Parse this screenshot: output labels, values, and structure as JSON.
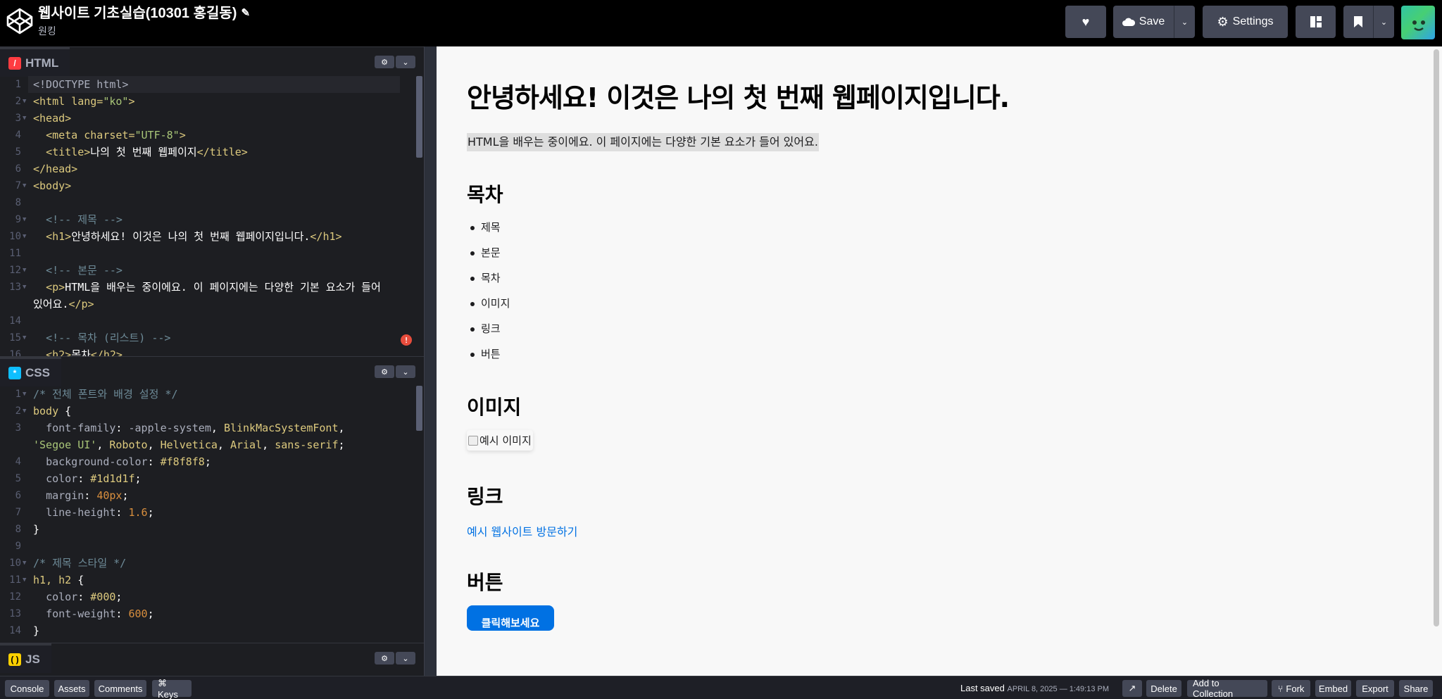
{
  "header": {
    "title": "웹사이트 기초실습(10301 홍길동)",
    "author": "원킹",
    "save_label": "Save",
    "settings_label": "Settings"
  },
  "editors": {
    "html": {
      "label": "HTML",
      "lines": [
        {
          "n": "1",
          "fold": false,
          "parts": [
            {
              "c": "c-prop",
              "t": "<!DOCTYPE html>"
            }
          ]
        },
        {
          "n": "2",
          "fold": true,
          "parts": [
            {
              "c": "c-tag",
              "t": "<html "
            },
            {
              "c": "c-attr",
              "t": "lang="
            },
            {
              "c": "c-str",
              "t": "\"ko\""
            },
            {
              "c": "c-tag",
              "t": ">"
            }
          ]
        },
        {
          "n": "3",
          "fold": true,
          "parts": [
            {
              "c": "c-tag",
              "t": "<head>"
            }
          ]
        },
        {
          "n": "4",
          "fold": false,
          "parts": [
            {
              "c": "",
              "t": "  "
            },
            {
              "c": "c-tag",
              "t": "<meta "
            },
            {
              "c": "c-attr",
              "t": "charset="
            },
            {
              "c": "c-str",
              "t": "\"UTF-8\""
            },
            {
              "c": "c-tag",
              "t": ">"
            }
          ]
        },
        {
          "n": "5",
          "fold": false,
          "parts": [
            {
              "c": "",
              "t": "  "
            },
            {
              "c": "c-tag",
              "t": "<title>"
            },
            {
              "c": "",
              "t": "나의 첫 번째 웹페이지"
            },
            {
              "c": "c-tag",
              "t": "</title>"
            }
          ]
        },
        {
          "n": "6",
          "fold": false,
          "parts": [
            {
              "c": "c-tag",
              "t": "</head>"
            }
          ]
        },
        {
          "n": "7",
          "fold": true,
          "parts": [
            {
              "c": "c-tag",
              "t": "<body>"
            }
          ]
        },
        {
          "n": "8",
          "fold": false,
          "parts": [
            {
              "c": "",
              "t": ""
            }
          ]
        },
        {
          "n": "9",
          "fold": true,
          "parts": [
            {
              "c": "",
              "t": "  "
            },
            {
              "c": "c-cmt",
              "t": "<!-- 제목 -->"
            }
          ]
        },
        {
          "n": "10",
          "fold": true,
          "parts": [
            {
              "c": "",
              "t": "  "
            },
            {
              "c": "c-tag",
              "t": "<h1>"
            },
            {
              "c": "",
              "t": "안녕하세요! 이것은 나의 첫 번째 웹페이지입니다."
            },
            {
              "c": "c-tag",
              "t": "</h1>"
            }
          ]
        },
        {
          "n": "11",
          "fold": false,
          "parts": [
            {
              "c": "",
              "t": ""
            }
          ]
        },
        {
          "n": "12",
          "fold": true,
          "parts": [
            {
              "c": "",
              "t": "  "
            },
            {
              "c": "c-cmt",
              "t": "<!-- 본문 -->"
            }
          ]
        },
        {
          "n": "13",
          "fold": true,
          "parts": [
            {
              "c": "",
              "t": "  "
            },
            {
              "c": "c-tag",
              "t": "<p>"
            },
            {
              "c": "",
              "t": "HTML을 배우는 중이에요. 이 페이지에는 다양한 기본 요소가 들어"
            }
          ]
        },
        {
          "n": "",
          "fold": false,
          "parts": [
            {
              "c": "",
              "t": "있어요."
            },
            {
              "c": "c-tag",
              "t": "</p>"
            }
          ]
        },
        {
          "n": "14",
          "fold": false,
          "parts": [
            {
              "c": "",
              "t": ""
            }
          ]
        },
        {
          "n": "15",
          "fold": true,
          "parts": [
            {
              "c": "",
              "t": "  "
            },
            {
              "c": "c-cmt",
              "t": "<!-- 목차 (리스트) -->"
            }
          ]
        },
        {
          "n": "16",
          "fold": false,
          "parts": [
            {
              "c": "",
              "t": "  "
            },
            {
              "c": "c-tag",
              "t": "<h2>"
            },
            {
              "c": "",
              "t": "목차"
            },
            {
              "c": "c-tag",
              "t": "</h2>"
            }
          ]
        }
      ]
    },
    "css": {
      "label": "CSS",
      "lines": [
        {
          "n": "1",
          "fold": true,
          "parts": [
            {
              "c": "c-cmt",
              "t": "/* 전체 폰트와 배경 설정 */"
            }
          ]
        },
        {
          "n": "2",
          "fold": true,
          "parts": [
            {
              "c": "c-sel",
              "t": "body"
            },
            {
              "c": "",
              "t": " {"
            }
          ]
        },
        {
          "n": "3",
          "fold": false,
          "parts": [
            {
              "c": "",
              "t": "  "
            },
            {
              "c": "c-prop",
              "t": "font-family"
            },
            {
              "c": "",
              "t": ": "
            },
            {
              "c": "c-prop",
              "t": "-apple-system"
            },
            {
              "c": "",
              "t": ", "
            },
            {
              "c": "c-sel",
              "t": "BlinkMacSystemFont"
            },
            {
              "c": "",
              "t": ","
            }
          ]
        },
        {
          "n": "",
          "fold": false,
          "parts": [
            {
              "c": "c-str",
              "t": "'Segoe UI'"
            },
            {
              "c": "",
              "t": ", "
            },
            {
              "c": "c-sel",
              "t": "Roboto"
            },
            {
              "c": "",
              "t": ", "
            },
            {
              "c": "c-sel",
              "t": "Helvetica"
            },
            {
              "c": "",
              "t": ", "
            },
            {
              "c": "c-sel",
              "t": "Arial"
            },
            {
              "c": "",
              "t": ", "
            },
            {
              "c": "c-sel",
              "t": "sans-serif"
            },
            {
              "c": "",
              "t": ";"
            }
          ]
        },
        {
          "n": "4",
          "fold": false,
          "parts": [
            {
              "c": "",
              "t": "  "
            },
            {
              "c": "c-prop",
              "t": "background-color"
            },
            {
              "c": "",
              "t": ": "
            },
            {
              "c": "c-num",
              "t": "#f8f8f8"
            },
            {
              "c": "",
              "t": ";"
            }
          ]
        },
        {
          "n": "5",
          "fold": false,
          "parts": [
            {
              "c": "",
              "t": "  "
            },
            {
              "c": "c-prop",
              "t": "color"
            },
            {
              "c": "",
              "t": ": "
            },
            {
              "c": "c-num",
              "t": "#1d1d1f"
            },
            {
              "c": "",
              "t": ";"
            }
          ]
        },
        {
          "n": "6",
          "fold": false,
          "parts": [
            {
              "c": "",
              "t": "  "
            },
            {
              "c": "c-prop",
              "t": "margin"
            },
            {
              "c": "",
              "t": ": "
            },
            {
              "c": "c-val",
              "t": "40px"
            },
            {
              "c": "",
              "t": ";"
            }
          ]
        },
        {
          "n": "7",
          "fold": false,
          "parts": [
            {
              "c": "",
              "t": "  "
            },
            {
              "c": "c-prop",
              "t": "line-height"
            },
            {
              "c": "",
              "t": ": "
            },
            {
              "c": "c-val",
              "t": "1.6"
            },
            {
              "c": "",
              "t": ";"
            }
          ]
        },
        {
          "n": "8",
          "fold": false,
          "parts": [
            {
              "c": "",
              "t": "}"
            }
          ]
        },
        {
          "n": "9",
          "fold": false,
          "parts": [
            {
              "c": "",
              "t": ""
            }
          ]
        },
        {
          "n": "10",
          "fold": true,
          "parts": [
            {
              "c": "c-cmt",
              "t": "/* 제목 스타일 */"
            }
          ]
        },
        {
          "n": "11",
          "fold": true,
          "parts": [
            {
              "c": "c-sel",
              "t": "h1, h2"
            },
            {
              "c": "",
              "t": " {"
            }
          ]
        },
        {
          "n": "12",
          "fold": false,
          "parts": [
            {
              "c": "",
              "t": "  "
            },
            {
              "c": "c-prop",
              "t": "color"
            },
            {
              "c": "",
              "t": ": "
            },
            {
              "c": "c-num",
              "t": "#000"
            },
            {
              "c": "",
              "t": ";"
            }
          ]
        },
        {
          "n": "13",
          "fold": false,
          "parts": [
            {
              "c": "",
              "t": "  "
            },
            {
              "c": "c-prop",
              "t": "font-weight"
            },
            {
              "c": "",
              "t": ": "
            },
            {
              "c": "c-val",
              "t": "600"
            },
            {
              "c": "",
              "t": ";"
            }
          ]
        },
        {
          "n": "14",
          "fold": false,
          "parts": [
            {
              "c": "",
              "t": "}"
            }
          ]
        }
      ]
    },
    "js": {
      "label": "JS"
    }
  },
  "preview": {
    "h1": "안녕하세요! 이것은 나의 첫 번째 웹페이지입니다.",
    "p": "HTML을 배우는 중이에요. 이 페이지에는 다양한 기본 요소가 들어 있어요.",
    "toc_heading": "목차",
    "toc_items": [
      "제목",
      "본문",
      "목차",
      "이미지",
      "링크",
      "버튼"
    ],
    "image_heading": "이미지",
    "image_alt": "예시 이미지",
    "link_heading": "링크",
    "link_text": "예시 웹사이트 방문하기",
    "button_heading": "버튼",
    "button_label": "클릭해보세요"
  },
  "footer": {
    "console": "Console",
    "assets": "Assets",
    "comments": "Comments",
    "keys": "⌘ Keys",
    "last_saved_label": "Last saved",
    "last_saved_date": "April 8, 2025 — 1:49:13 PM",
    "delete": "Delete",
    "add_to_collection": "Add to Collection",
    "fork": "Fork",
    "embed": "Embed",
    "export": "Export",
    "share": "Share"
  },
  "colors": {
    "html_icon": "#ff3c41",
    "css_icon": "#0ebeff",
    "js_icon": "#fcd000",
    "link": "#0071e3",
    "error": "#e74c3c"
  }
}
